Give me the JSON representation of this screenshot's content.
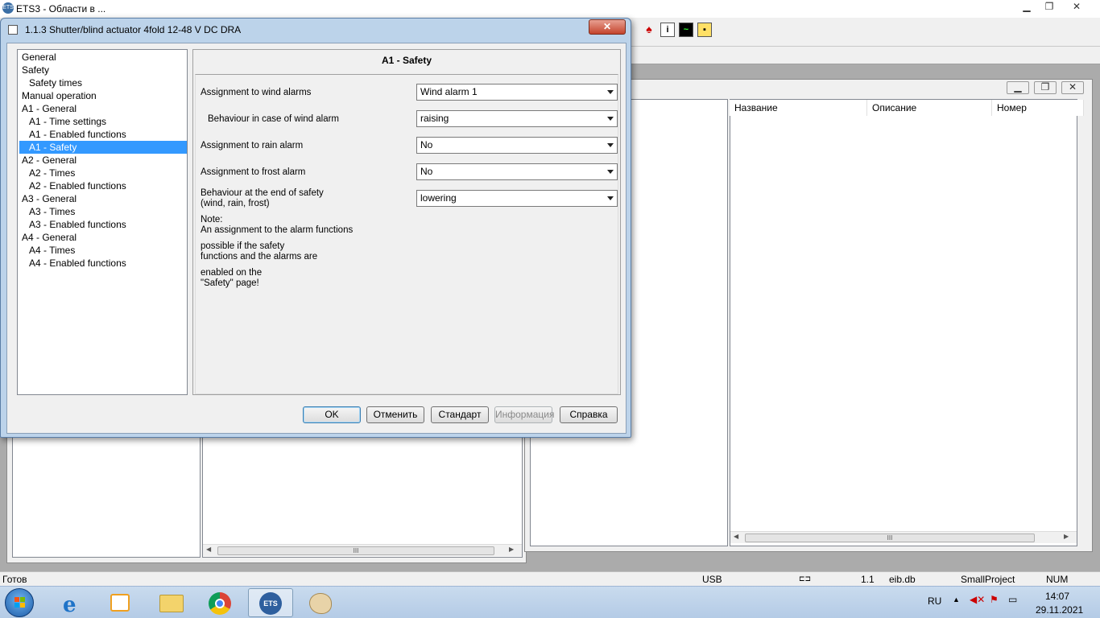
{
  "app": {
    "title": "ETS3 - Области в ...",
    "logo": "ETS"
  },
  "dialog": {
    "title": "1.1.3 Shutter/blind actuator 4fold 12-48 V DC DRA",
    "close_glyph": "✕",
    "nav": [
      {
        "label": "General",
        "indent": 0
      },
      {
        "label": "Safety",
        "indent": 0
      },
      {
        "label": "Safety times",
        "indent": 1
      },
      {
        "label": "Manual operation",
        "indent": 0
      },
      {
        "label": "A1 - General",
        "indent": 0
      },
      {
        "label": "A1 - Time settings",
        "indent": 1
      },
      {
        "label": "A1 - Enabled functions",
        "indent": 1
      },
      {
        "label": "A1 - Safety",
        "indent": 1,
        "selected": true
      },
      {
        "label": "A2 - General",
        "indent": 0
      },
      {
        "label": "A2 - Times",
        "indent": 1
      },
      {
        "label": "A2 - Enabled functions",
        "indent": 1
      },
      {
        "label": "A3 - General",
        "indent": 0
      },
      {
        "label": "A3 - Times",
        "indent": 1
      },
      {
        "label": "A3 - Enabled functions",
        "indent": 1
      },
      {
        "label": "A4 - General",
        "indent": 0
      },
      {
        "label": "A4 - Times",
        "indent": 1
      },
      {
        "label": "A4 - Enabled functions",
        "indent": 1
      }
    ],
    "page_title": "A1 - Safety",
    "params": {
      "wind_assign": {
        "label": "Assignment to wind alarms",
        "value": "Wind alarm 1"
      },
      "wind_behaviour": {
        "label": "Behaviour in case of wind alarm",
        "value": "raising"
      },
      "rain_assign": {
        "label": "Assignment to rain alarm",
        "value": "No"
      },
      "frost_assign": {
        "label": "Assignment to frost alarm",
        "value": "No"
      },
      "end_behaviour": {
        "label_line1": "Behaviour at the end of safety",
        "label_line2": "(wind, rain, frost)",
        "value": "lowering"
      }
    },
    "note": {
      "line1": "Note:",
      "line2": "An assignment to the alarm functions",
      "line3": "possible if the safety",
      "line4": "functions and the alarms are",
      "line5": "enabled on the",
      "line6": "\"Safety\" page!"
    },
    "buttons": {
      "ok": "OK",
      "cancel": "Отменить",
      "standard": "Стандарт",
      "info": "Информация",
      "help": "Справка"
    }
  },
  "right_window": {
    "columns": [
      "Название",
      "Описание",
      "Номер"
    ]
  },
  "scroll_thumb": "III",
  "statusbar": {
    "ready": "Готов",
    "interface": "USB",
    "address": "1.1",
    "database": "eib.db",
    "project": "SmallProject",
    "numlock": "NUM"
  },
  "taskbar": {
    "language": "RU",
    "time": "14:07",
    "date": "29.11.2021"
  }
}
